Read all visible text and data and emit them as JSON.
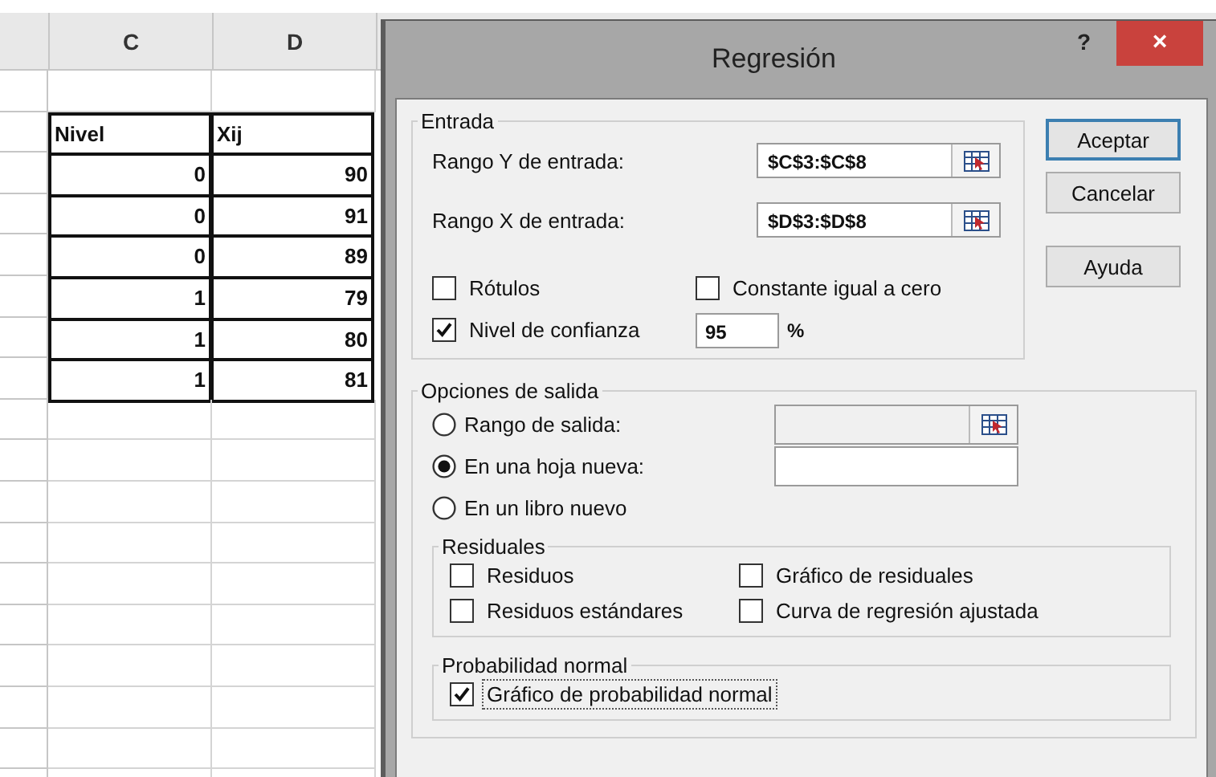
{
  "sheet": {
    "columns": [
      "C",
      "D"
    ],
    "table": {
      "header": [
        "Nivel",
        "Xij"
      ],
      "rows": [
        [
          "0",
          "90"
        ],
        [
          "0",
          "91"
        ],
        [
          "0",
          "89"
        ],
        [
          "1",
          "79"
        ],
        [
          "1",
          "80"
        ],
        [
          "1",
          "81"
        ]
      ]
    }
  },
  "dialog": {
    "title": "Regresión",
    "help": "?",
    "close": "×",
    "input_group": {
      "title": "Entrada",
      "ranges": [
        {
          "label": "Rango Y de entrada:",
          "value": "$C$3:$C$8"
        },
        {
          "label": "Rango X de entrada:",
          "value": "$D$3:$D$8"
        }
      ],
      "options": [
        {
          "label": "Rótulos",
          "checked": false,
          "focused": false
        },
        {
          "label": "Constante igual a cero",
          "checked": false,
          "focused": false
        }
      ],
      "confidence": {
        "label": "Nivel de confianza",
        "checked": true,
        "focused": false,
        "value": "95",
        "unit": "%"
      }
    },
    "buttons": [
      {
        "label": "Aceptar",
        "default": true
      },
      {
        "label": "Cancelar",
        "default": false
      },
      {
        "label": "Ayuda",
        "default": false
      }
    ],
    "output_group": {
      "title": "Opciones de salida",
      "destinations": [
        {
          "label": "Rango de salida:",
          "selected": false,
          "kind": "picker",
          "disabled": true
        },
        {
          "label": "En una hoja nueva:",
          "selected": true,
          "kind": "text",
          "disabled": false
        },
        {
          "label": "En un libro nuevo",
          "selected": false,
          "kind": "none"
        }
      ],
      "residuals": {
        "title": "Residuales",
        "options": [
          {
            "label": "Residuos",
            "checked": false,
            "focused": false
          },
          {
            "label": "Gráfico de residuales",
            "checked": false,
            "focused": false
          },
          {
            "label": "Residuos estándares",
            "checked": false,
            "focused": false
          },
          {
            "label": "Curva de regresión ajustada",
            "checked": false,
            "focused": false
          }
        ]
      },
      "normal_probability": {
        "title": "Probabilidad normal",
        "options": [
          {
            "label": "Gráfico de probabilidad normal",
            "checked": true,
            "focused": true
          }
        ]
      }
    }
  }
}
